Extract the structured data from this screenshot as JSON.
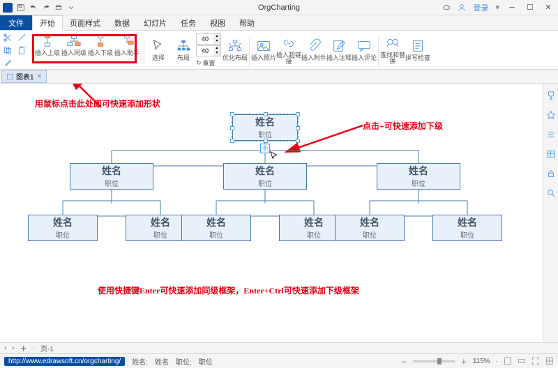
{
  "app": {
    "title": "OrgCharting",
    "login": "登录",
    "logo_name": "app-logo"
  },
  "menus": {
    "file": "文件",
    "items": [
      "开始",
      "页面样式",
      "数据",
      "幻灯片",
      "任务",
      "视图",
      "帮助"
    ],
    "active_index": 0
  },
  "ribbon": {
    "insert": [
      {
        "label": "插入上级",
        "name": "insert-superior-button"
      },
      {
        "label": "插入同级",
        "name": "insert-peer-button"
      },
      {
        "label": "插入下级",
        "name": "insert-subordinate-button"
      },
      {
        "label": "插入助手",
        "name": "insert-assistant-button"
      }
    ],
    "select": {
      "label": "选择",
      "name": "select-button"
    },
    "layout": {
      "label": "布局",
      "name": "layout-button"
    },
    "spin1": "40",
    "spin2": "40",
    "recalc": "重置",
    "optimize": {
      "label": "优化布局",
      "name": "optimize-layout-button"
    },
    "more": [
      {
        "label": "插入照片",
        "name": "insert-photo-button"
      },
      {
        "label": "插入超链接",
        "name": "insert-hyperlink-button"
      },
      {
        "label": "插入附件",
        "name": "insert-attachment-button"
      },
      {
        "label": "插入注释",
        "name": "insert-note-button"
      },
      {
        "label": "插入评论",
        "name": "insert-comment-button"
      },
      {
        "label": "查找和替换",
        "name": "find-replace-button"
      },
      {
        "label": "拼写检查",
        "name": "spellcheck-button"
      }
    ]
  },
  "doc": {
    "tab": "图表1"
  },
  "annotations": {
    "top": "用鼠标点击此处即可快速添加形状",
    "right": "点击+可快速添加下级",
    "bottom": "使用快捷键Enter可快速添加同级框架，Enter+Ctrl可快速添加下级框架"
  },
  "node": {
    "name": "姓名",
    "position": "职位"
  },
  "pages": {
    "nav_prev": "‹",
    "nav_next": "›",
    "add": "＋",
    "page1": "页-1"
  },
  "status": {
    "url": "http://www.edrawsoft.cn/orgcharting/",
    "info_name_label": "姓名:",
    "info_name_value": "姓名",
    "info_pos_label": "职位:",
    "info_pos_value": "职位",
    "zoom_minus": "－",
    "zoom_plus": "＋",
    "zoom": "115%"
  }
}
